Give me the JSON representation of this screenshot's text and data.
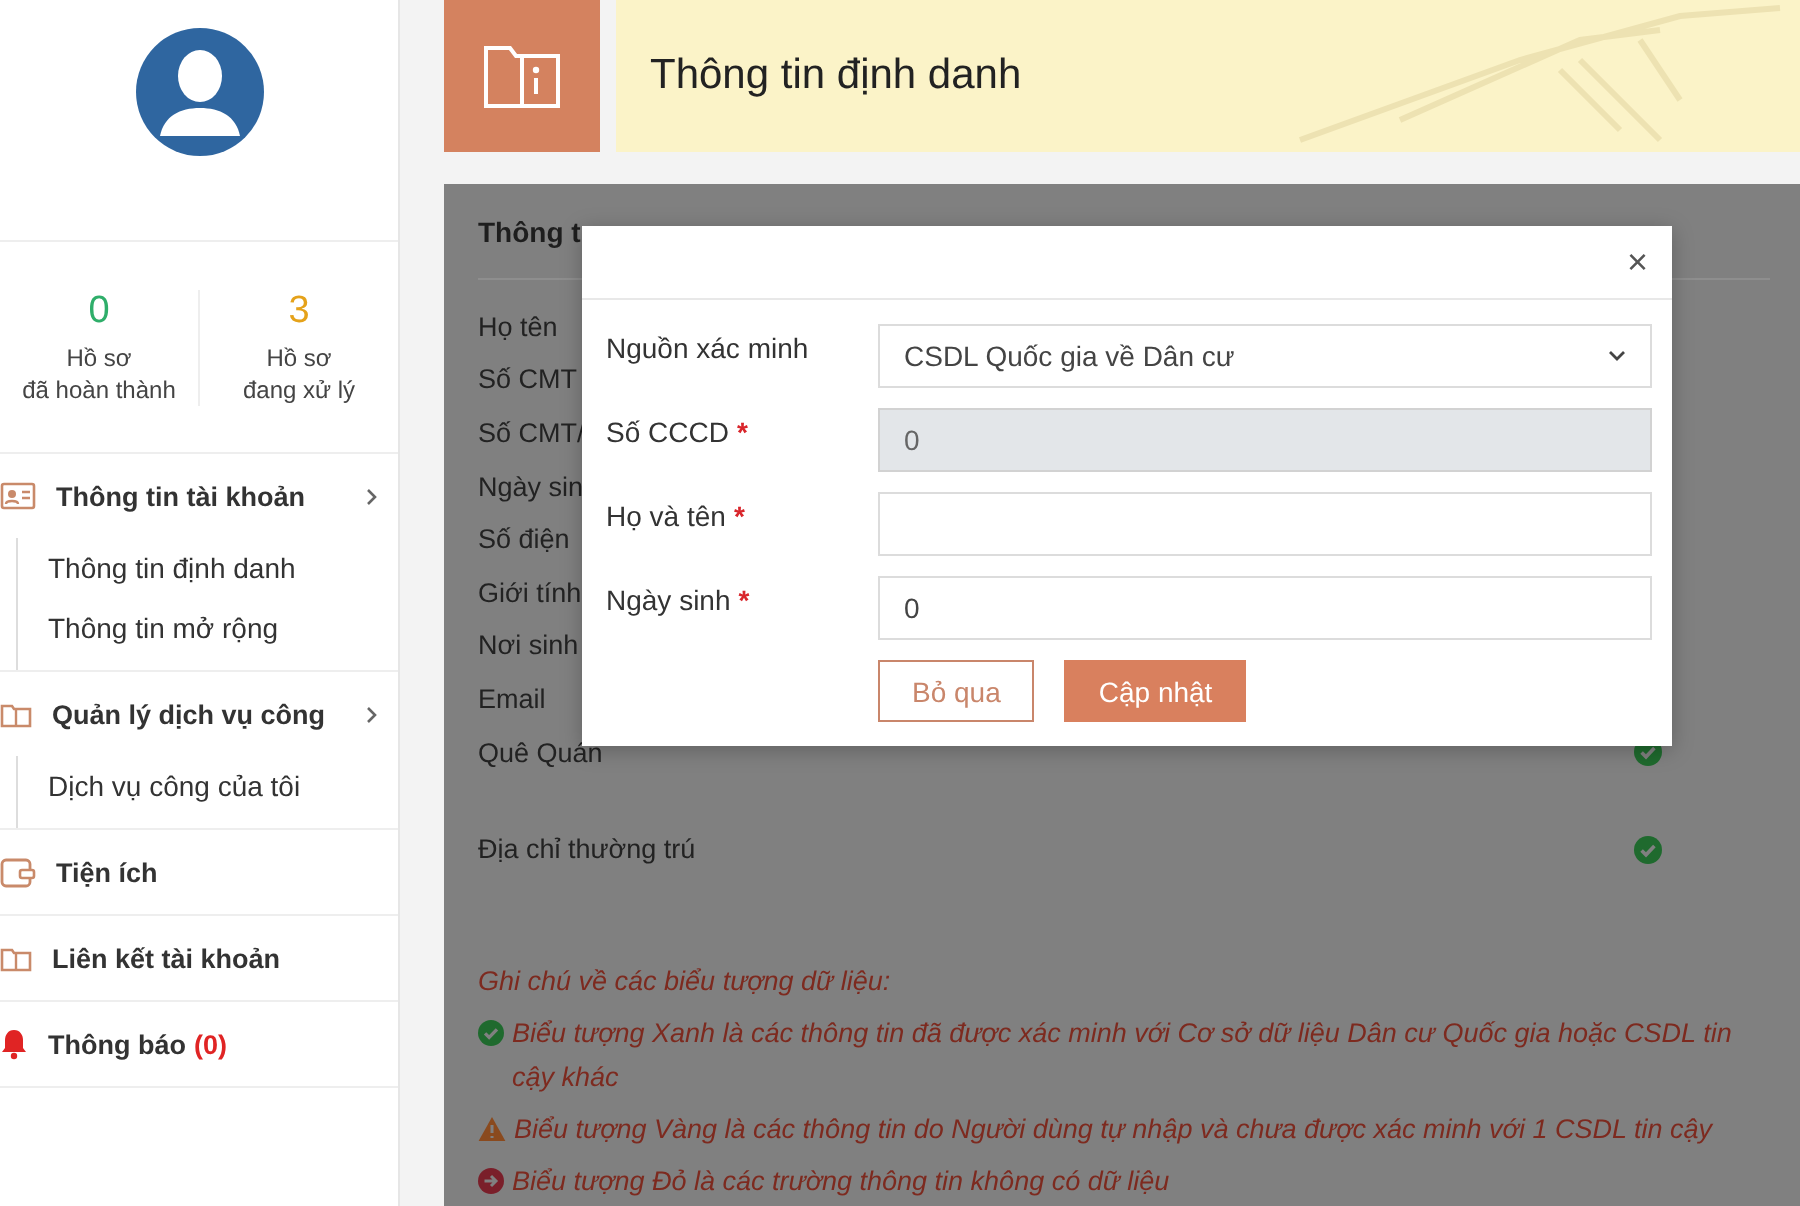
{
  "sidebar": {
    "stats": [
      {
        "count": "0",
        "label_line1": "Hồ sơ",
        "label_line2": "đã hoàn thành",
        "kind": "done"
      },
      {
        "count": "3",
        "label_line1": "Hồ sơ",
        "label_line2": "đang xử lý",
        "kind": "pending"
      }
    ],
    "menu": [
      {
        "label": "Thông tin tài khoản",
        "kind": "account",
        "children": [
          {
            "label": "Thông tin định danh"
          },
          {
            "label": "Thông tin mở rộng"
          }
        ]
      },
      {
        "label": "Quản lý dịch vụ công",
        "kind": "services",
        "children": [
          {
            "label": "Dịch vụ công của tôi"
          }
        ]
      },
      {
        "label": "Tiện ích",
        "kind": "utilities"
      },
      {
        "label": "Liên kết tài khoản",
        "kind": "links"
      },
      {
        "label": "Thông báo",
        "kind": "notifications",
        "count": "(0)"
      }
    ]
  },
  "header": {
    "title": "Thông tin định danh"
  },
  "panel": {
    "title": "Thông t",
    "rows": [
      {
        "label": "Họ tên"
      },
      {
        "label": "Số CMT"
      },
      {
        "label": "Số CMT/"
      },
      {
        "label": "Ngày sin"
      },
      {
        "label": "Số điện"
      },
      {
        "label": "Giới tính"
      },
      {
        "label": "Nơi sinh"
      },
      {
        "label": "Email"
      },
      {
        "label": "Quê Quán",
        "verified": true
      },
      {
        "label": "Địa chỉ thường trú",
        "verified": true
      }
    ],
    "notes_title": "Ghi chú về các biểu tượng dữ liệu:",
    "notes": [
      {
        "kind": "green",
        "text": "Biểu tượng Xanh là các thông tin đã được xác minh với Cơ sở dữ liệu Dân cư Quốc gia hoặc CSDL tin cậy khác"
      },
      {
        "kind": "warning",
        "text": "Biểu tượng Vàng là các thông tin do Người dùng tự nhập và chưa được xác minh với 1 CSDL tin cậy"
      },
      {
        "kind": "red",
        "text": "Biểu tượng Đỏ là các trường thông tin không có dữ liệu"
      }
    ]
  },
  "modal": {
    "close": "×",
    "fields": [
      {
        "kind": "select",
        "label": "Nguồn xác minh",
        "value": "CSDL Quốc gia về Dân cư"
      },
      {
        "kind": "input",
        "label": "Số CCCD",
        "required_mark": "*",
        "value": "0",
        "disabled": true
      },
      {
        "kind": "input",
        "label": "Họ và tên",
        "required_mark": "*",
        "disabled": false
      },
      {
        "kind": "input",
        "label": "Ngày sinh",
        "required_mark": "*",
        "value": "0",
        "disabled": false
      }
    ],
    "buttons": [
      {
        "kind": "secondary",
        "label": "Bỏ qua"
      },
      {
        "kind": "primary",
        "label": "Cập nhật"
      }
    ]
  }
}
